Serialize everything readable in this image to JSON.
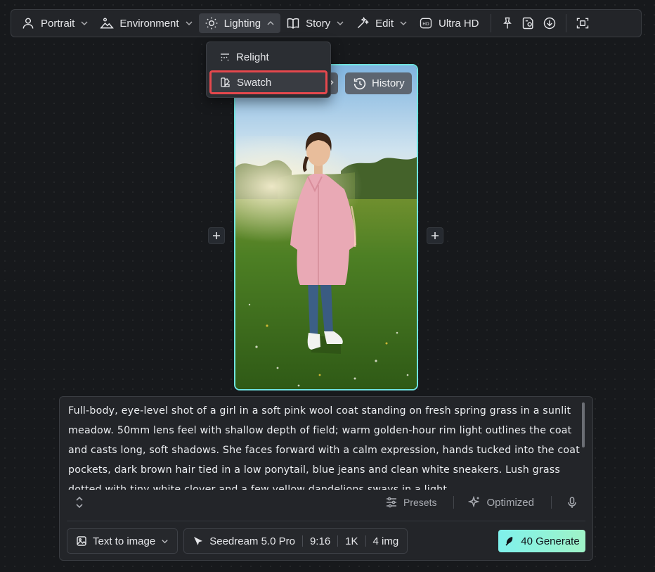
{
  "toolbar": {
    "portrait": "Portrait",
    "environment": "Environment",
    "lighting": "Lighting",
    "story": "Story",
    "edit": "Edit",
    "ultra_hd": "Ultra HD"
  },
  "lighting_menu": {
    "items": [
      "Relight",
      "Swatch"
    ],
    "highlighted": "Swatch"
  },
  "image": {
    "history_label": "History"
  },
  "prompt": {
    "text": "Full-body, eye-level shot of a girl in a soft pink wool coat standing on fresh spring grass in a sunlit meadow. 50mm lens feel with shallow depth of field; warm golden-hour rim light outlines the coat and casts long, soft shadows. She faces forward with a calm expression, hands tucked into the coat pockets, dark brown hair tied in a low ponytail, blue jeans and clean white sneakers. Lush grass dotted with tiny white clover and a few yellow dandelions sways in a light",
    "presets_label": "Presets",
    "optimized_label": "Optimized"
  },
  "generation": {
    "mode": "Text to image",
    "model": "Seedream 5.0 Pro",
    "aspect_ratio": "9:16",
    "resolution": "1K",
    "count": "4 img",
    "generate_label": "40 Generate"
  },
  "colors": {
    "accent_cyan": "#6fe3e0",
    "highlight_red": "#e5484d",
    "generate_gradient_start": "#7ff1ec",
    "generate_gradient_end": "#9ff3c7"
  }
}
